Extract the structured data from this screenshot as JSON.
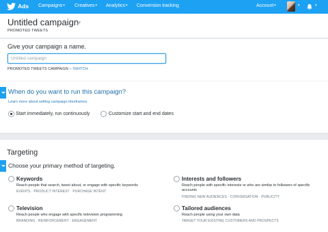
{
  "topbar": {
    "brand": "Ads",
    "nav": [
      "Campaigns",
      "Creatives",
      "Analytics"
    ],
    "conversion": "Conversion tracking",
    "account": "Account",
    "caret": "▾"
  },
  "header": {
    "title": "Untitled campaign",
    "subtitle": "PROMOTED TWEETS"
  },
  "name_section": {
    "heading": "Give your campaign a name.",
    "input_placeholder": "Untitled campaign",
    "input_value": "",
    "type_label": "PROMOTED TWEETS CAMPAIGN – ",
    "switch_label": "SWITCH"
  },
  "schedule": {
    "heading": "When do you want to run this campaign?",
    "learn_more": "Learn more about setting campaign timeframes.",
    "options": [
      {
        "label": "Start immediately, run continuously",
        "checked": true
      },
      {
        "label": "Customize start and end dates",
        "checked": false
      }
    ]
  },
  "targeting": {
    "title": "Targeting",
    "heading": "Choose your primary method of targeting.",
    "options": [
      {
        "title": "Keywords",
        "desc": "Reach people that search, tweet about, or engage with specific keywords",
        "tags": "EVENTS · PRODUCT INTEREST · PURCHASE INTENT"
      },
      {
        "title": "Interests and followers",
        "desc": "Reach people with specific interests or who are similar to followers of specific accounts",
        "tags": "FINDING NEW AUDIENCES · CONVERSATION · PUBLICITY"
      },
      {
        "title": "Television",
        "desc": "Reach people who engage with specific television programming",
        "tags": "BRANDING · REINFORCEMENT · ENGAGEMENT"
      },
      {
        "title": "Tailored audiences",
        "desc": "Reach people using your own data",
        "tags": "TARGET YOUR EXISTING CUSTOMERS AND PROSPECTS"
      }
    ]
  },
  "icons": {
    "logo": "twitter-bird-icon",
    "pencil": "pencil-icon",
    "bell": "notifications-icon",
    "avatar": "user-avatar"
  },
  "colors": {
    "topbar": "#1da1f2",
    "link": "#2b7bb9",
    "heading_blue": "#1f6fa8",
    "input_focus": "#3ba1e4",
    "page_bg": "#e7ebee"
  }
}
